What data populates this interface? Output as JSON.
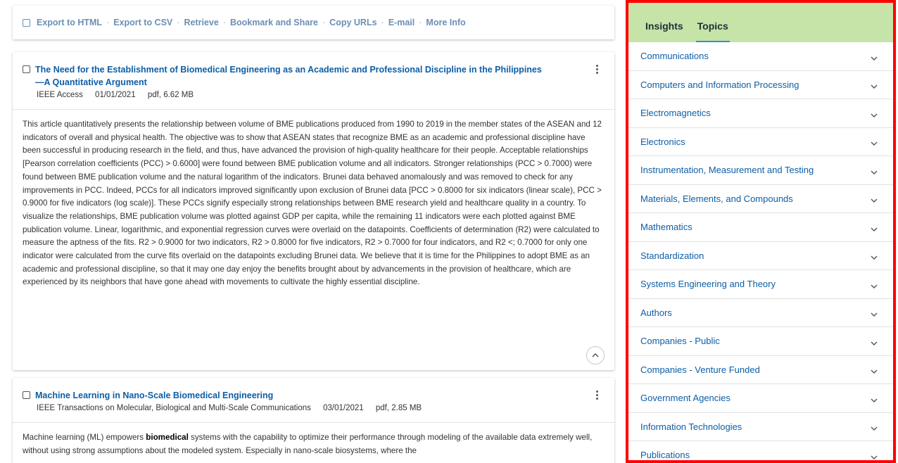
{
  "toolbar": {
    "items": [
      "Export to HTML",
      "Export to CSV",
      "Retrieve",
      "Bookmark and Share",
      "Copy URLs",
      "E-mail",
      "More Info"
    ]
  },
  "results": [
    {
      "title": "The Need for the Establishment of Biomedical Engineering as an Academic and Professional Discipline in the Philippines—A Quantitative Argument",
      "journal": "IEEE Access",
      "date": "01/01/2021",
      "file": "pdf, 6.62 MB",
      "abstract": "This article quantitatively presents the relationship between volume of BME publications produced from 1990 to 2019 in the member states of the ASEAN and 12 indicators of overall and physical health. The objective was to show that ASEAN states that recognize BME as an academic and professional discipline have been successful in producing research in the field, and thus, have advanced the provision of high-quality healthcare for their people. Acceptable relationships [Pearson correlation coefficients (PCC) > 0.6000] were found between BME publication volume and all indicators. Stronger relationships (PCC > 0.7000) were found between BME publication volume and the natural logarithm of the indicators. Brunei data behaved anomalously and was removed to check for any improvements in PCC. Indeed, PCCs for all indicators improved significantly upon exclusion of Brunei data [PCC > 0.8000 for six indicators (linear scale), PCC > 0.9000 for five indicators (log scale)]. These PCCs signify especially strong relationships between BME research yield and healthcare quality in a country. To visualize the relationships, BME publication volume was plotted against GDP per capita, while the remaining 11 indicators were each plotted against BME publication volume. Linear, logarithmic, and exponential regression curves were overlaid on the datapoints. Coefficients of determination (R2) were calculated to measure the aptness of the fits. R2 > 0.9000 for two indicators, R2 > 0.8000 for five indicators, R2 > 0.7000 for four indicators, and R2 <; 0.7000 for only one indicator were calculated from the curve fits overlaid on the datapoints excluding Brunei data. We believe that it is time for the Philippines to adopt BME as an academic and professional discipline, so that it may one day enjoy the benefits brought about by advancements in the provision of healthcare, which are experienced by its neighbors that have gone ahead with movements to cultivate the highly essential discipline."
    },
    {
      "title": "Machine Learning in Nano-Scale Biomedical Engineering",
      "journal": "IEEE Transactions on Molecular, Biological and Multi-Scale Communications",
      "date": "03/01/2021",
      "file": "pdf, 2.85 MB",
      "abstract_pre": "Machine learning (ML) empowers ",
      "abstract_bold": "biomedical",
      "abstract_post": " systems with the capability to optimize their performance through modeling of the available data extremely well, without using strong assumptions about the modeled system. Especially in nano-scale biosystems, where the"
    }
  ],
  "panel": {
    "tabs": [
      "Insights",
      "Topics"
    ],
    "active_tab": "Topics",
    "header_color": "#c6e3a8",
    "border_color": "#ff0000",
    "topics": [
      "Communications",
      "Computers and Information Processing",
      "Electromagnetics",
      "Electronics",
      "Instrumentation, Measurement and Testing",
      "Materials, Elements, and Compounds",
      "Mathematics",
      "Standardization",
      "Systems Engineering and Theory",
      "Authors",
      "Companies - Public",
      "Companies - Venture Funded",
      "Government Agencies",
      "Information Technologies",
      "Publications"
    ]
  }
}
